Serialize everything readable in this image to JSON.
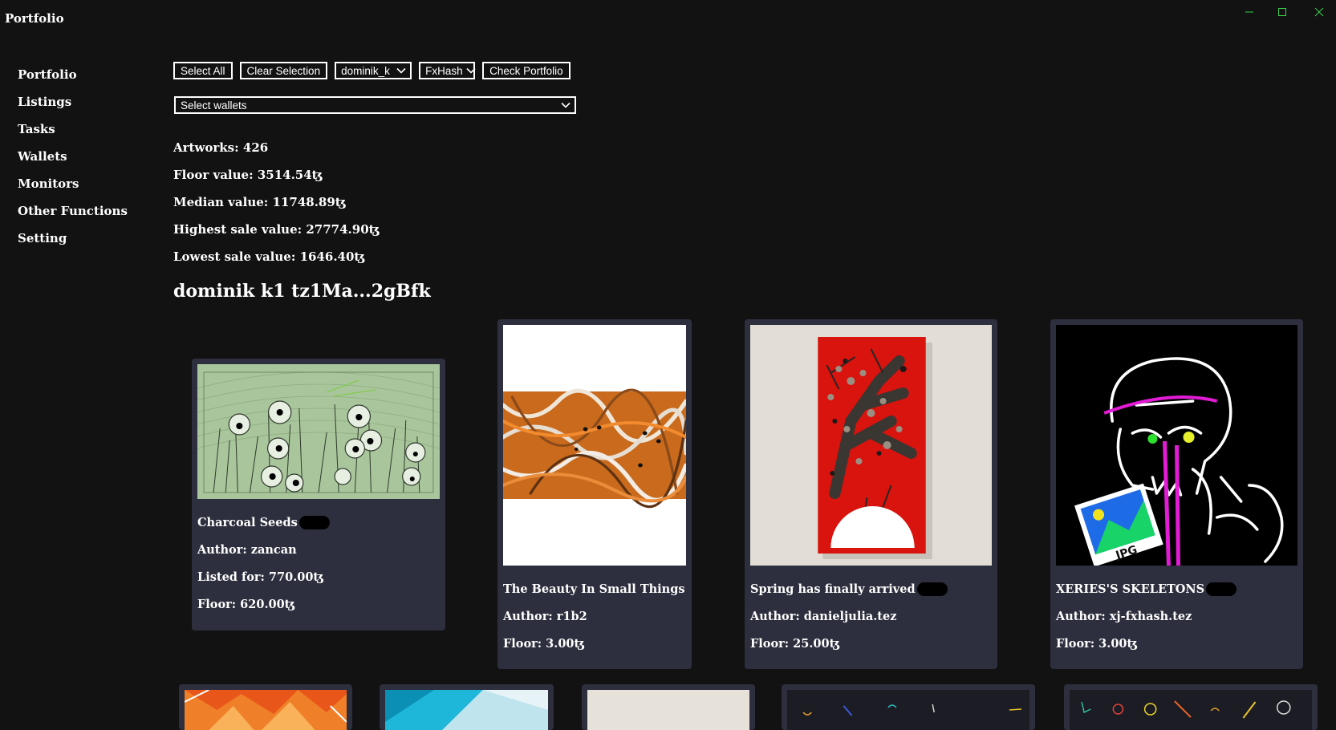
{
  "window": {
    "title": "Portfolio",
    "accent": "#3bd14a"
  },
  "sidebar": {
    "items": [
      {
        "label": "Portfolio"
      },
      {
        "label": "Listings"
      },
      {
        "label": "Tasks"
      },
      {
        "label": "Wallets"
      },
      {
        "label": "Monitors"
      },
      {
        "label": "Other Functions"
      },
      {
        "label": "Setting"
      }
    ]
  },
  "toolbar": {
    "select_all_label": "Select All",
    "clear_selection_label": "Clear Selection",
    "user_select_value": "dominik_k",
    "platform_select_value": "FxHash",
    "check_portfolio_label": "Check Portfolio",
    "wallets_select_value": "Select wallets"
  },
  "stats": {
    "artworks": "Artworks: 426",
    "floor_value": "Floor value: 3514.54ꜩ",
    "median_value": "Median value: 11748.89ꜩ",
    "highest_sale": "Highest sale value: 27774.90ꜩ",
    "lowest_sale": "Lowest sale value: 1646.40ꜩ"
  },
  "wallet_heading": "dominik k1 tz1Ma...2gBfk",
  "cards": [
    {
      "title": "Charcoal Seeds",
      "author": "Author: zancan",
      "listed": "Listed for: 770.00ꜩ",
      "floor": "Floor: 620.00ꜩ",
      "art": "charcoal-seeds-artwork"
    },
    {
      "title": "The Beauty In Small Things",
      "author": "Author: r1b2",
      "floor": "Floor: 3.00ꜩ",
      "art": "beauty-in-small-things-artwork"
    },
    {
      "title": "Spring has finally arrived",
      "author": "Author: danieljulia.tez",
      "floor": "Floor: 25.00ꜩ",
      "art": "spring-has-finally-arrived-artwork"
    },
    {
      "title": "XERIES'S SKELETONS",
      "author": "Author: xj-fxhash.tez",
      "floor": "Floor: 3.00ꜩ",
      "art": "xeries-skeletons-artwork"
    }
  ],
  "card_bg": "#2d2f3e"
}
